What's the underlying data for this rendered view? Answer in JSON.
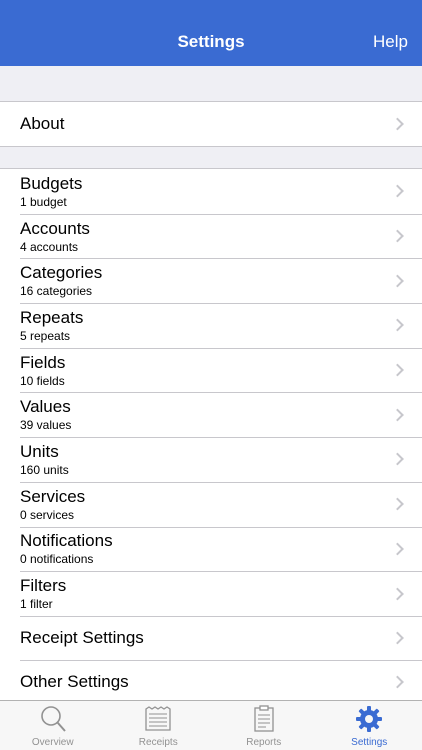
{
  "navbar": {
    "title": "Settings",
    "help_label": "Help"
  },
  "about": {
    "title": "About"
  },
  "items": [
    {
      "title": "Budgets",
      "subtitle": "1 budget"
    },
    {
      "title": "Accounts",
      "subtitle": "4 accounts"
    },
    {
      "title": "Categories",
      "subtitle": "16 categories"
    },
    {
      "title": "Repeats",
      "subtitle": "5 repeats"
    },
    {
      "title": "Fields",
      "subtitle": "10 fields"
    },
    {
      "title": "Values",
      "subtitle": "39 values"
    },
    {
      "title": "Units",
      "subtitle": "160 units"
    },
    {
      "title": "Services",
      "subtitle": "0 services"
    },
    {
      "title": "Notifications",
      "subtitle": "0 notifications"
    },
    {
      "title": "Filters",
      "subtitle": "1 filter"
    }
  ],
  "settings": [
    {
      "title": "Receipt Settings"
    },
    {
      "title": "Other Settings"
    }
  ],
  "tabs": [
    {
      "label": "Overview",
      "icon": "magnifier-icon"
    },
    {
      "label": "Receipts",
      "icon": "receipt-icon"
    },
    {
      "label": "Reports",
      "icon": "clipboard-icon"
    },
    {
      "label": "Settings",
      "icon": "gear-icon",
      "active": true
    }
  ],
  "colors": {
    "accent": "#3a6bd2",
    "inactive": "#929292",
    "background": "#efeff4"
  }
}
